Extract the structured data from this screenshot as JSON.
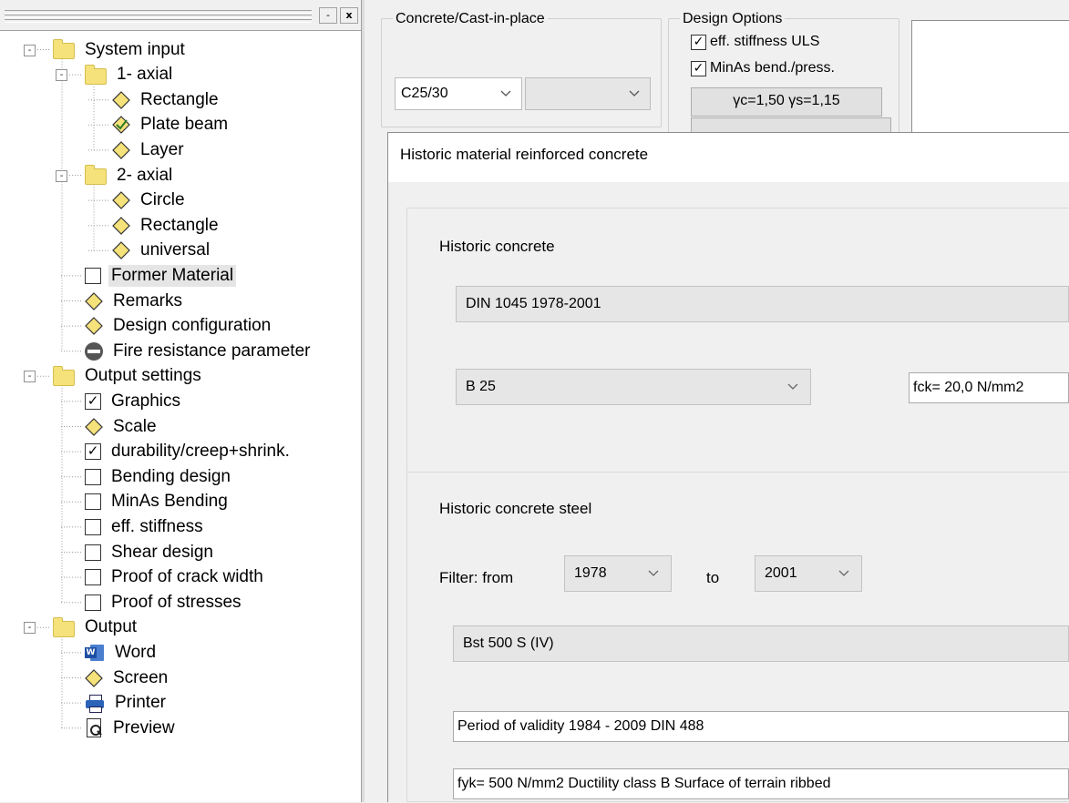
{
  "tree": {
    "titlebar": {
      "minimize": "-",
      "close": "x"
    },
    "items": [
      {
        "id": "system-input",
        "label": "System input",
        "icon": "folder-icon",
        "expander": "-"
      },
      {
        "id": "1-axial",
        "label": "1- axial",
        "icon": "folder-icon",
        "expander": "-"
      },
      {
        "id": "rectangle-1",
        "label": "Rectangle",
        "icon": "diamond-icon"
      },
      {
        "id": "plate-beam",
        "label": "Plate beam",
        "icon": "diamond-check-icon"
      },
      {
        "id": "layer",
        "label": "Layer",
        "icon": "diamond-icon"
      },
      {
        "id": "2-axial",
        "label": "2- axial",
        "icon": "folder-icon",
        "expander": "-"
      },
      {
        "id": "circle",
        "label": "Circle",
        "icon": "diamond-icon"
      },
      {
        "id": "rectangle-2",
        "label": "Rectangle",
        "icon": "diamond-icon"
      },
      {
        "id": "universal",
        "label": "universal",
        "icon": "diamond-icon"
      },
      {
        "id": "former-material",
        "label": "Former Material",
        "icon": "checkbox",
        "checked": false,
        "selected": true
      },
      {
        "id": "remarks",
        "label": "Remarks",
        "icon": "diamond-icon"
      },
      {
        "id": "design-configuration",
        "label": "Design  configuration",
        "icon": "diamond-icon"
      },
      {
        "id": "fire-resistance",
        "label": "Fire resistance parameter",
        "icon": "stop-icon"
      },
      {
        "id": "output-settings",
        "label": "Output settings",
        "icon": "folder-icon",
        "expander": "-"
      },
      {
        "id": "graphics",
        "label": "Graphics",
        "icon": "checkbox",
        "checked": true
      },
      {
        "id": "scale",
        "label": "Scale",
        "icon": "diamond-icon"
      },
      {
        "id": "durability",
        "label": "durability/creep+shrink.",
        "icon": "checkbox",
        "checked": true
      },
      {
        "id": "bending-design",
        "label": "Bending design",
        "icon": "checkbox",
        "checked": false
      },
      {
        "id": "minas-bending",
        "label": "MinAs Bending",
        "icon": "checkbox",
        "checked": false
      },
      {
        "id": "eff-stiffness",
        "label": "eff. stiffness",
        "icon": "checkbox",
        "checked": false
      },
      {
        "id": "shear-design",
        "label": "Shear design",
        "icon": "checkbox",
        "checked": false
      },
      {
        "id": "crack-width",
        "label": "Proof of crack width",
        "icon": "checkbox",
        "checked": false
      },
      {
        "id": "proof-stresses",
        "label": "Proof of stresses",
        "icon": "checkbox",
        "checked": false
      },
      {
        "id": "output",
        "label": "Output",
        "icon": "folder-icon",
        "expander": "-"
      },
      {
        "id": "word",
        "label": "Word",
        "icon": "word-icon"
      },
      {
        "id": "screen",
        "label": "Screen",
        "icon": "diamond-icon"
      },
      {
        "id": "printer",
        "label": "Printer",
        "icon": "printer-icon"
      },
      {
        "id": "preview",
        "label": "Preview",
        "icon": "preview-icon"
      }
    ],
    "check_mark": "✓"
  },
  "concrete": {
    "group_title": "Concrete/Cast-in-place",
    "grade": "C25/30",
    "second": ""
  },
  "design_options": {
    "group_title": "Design  Options",
    "eff_stiffness_uls": "eff. stiffness ULS",
    "minas": "MinAs bend./press.",
    "gamma": "γc=1,50  γs=1,15",
    "check_mark": "✓"
  },
  "dialog": {
    "title": "Historic material reinforced concrete",
    "concrete": {
      "heading": "Historic concrete",
      "norm": "DIN 1045 1978-2001",
      "class": "B 25",
      "fck": "fck= 20,0 N/mm2"
    },
    "steel": {
      "heading": "Historic concrete steel",
      "filter_label": "Filter:  from",
      "from": "1978",
      "to_label": "to",
      "to": "2001",
      "type": "Bst 500 S (IV)",
      "validity": "Period of validity  1984 - 2009     DIN 488",
      "props": "fyk= 500 N/mm2  Ductility class  B    Surface of terrain ribbed"
    }
  },
  "colors": {
    "folder": "#f5e27a",
    "diamond": "#f6e27a",
    "accent_blue": "#2a63b8"
  }
}
